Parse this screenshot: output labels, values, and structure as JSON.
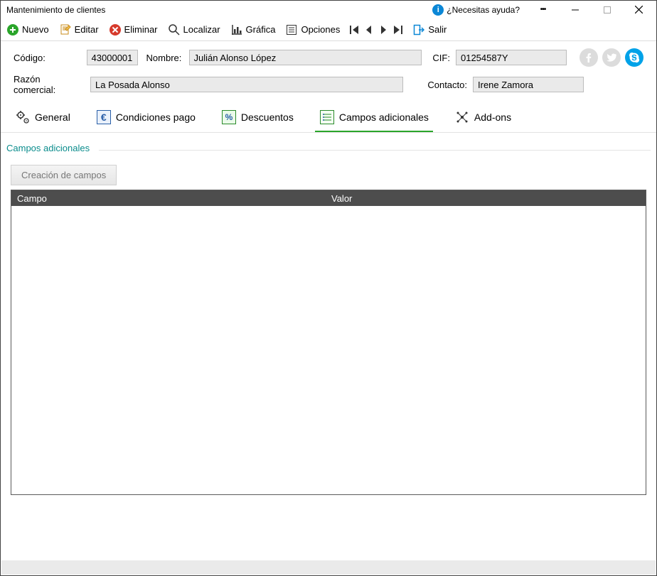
{
  "window": {
    "title": "Mantenimiento de clientes",
    "help_text": "¿Necesitas ayuda?"
  },
  "toolbar": {
    "nuevo": "Nuevo",
    "editar": "Editar",
    "eliminar": "Eliminar",
    "localizar": "Localizar",
    "grafica": "Gráfica",
    "opciones": "Opciones",
    "salir": "Salir"
  },
  "form": {
    "codigo_label": "Código:",
    "codigo_value": "43000001",
    "nombre_label": "Nombre:",
    "nombre_value": "Julián Alonso López",
    "cif_label": "CIF:",
    "cif_value": "01254587Y",
    "razon_label": "Razón comercial:",
    "razon_value": "La Posada Alonso",
    "contacto_label": "Contacto:",
    "contacto_value": "Irene Zamora"
  },
  "tabs": {
    "general": "General",
    "condiciones": "Condiciones pago",
    "descuentos": "Descuentos",
    "campos": "Campos adicionales",
    "addons": "Add-ons"
  },
  "section": {
    "title": "Campos adicionales",
    "create_btn": "Creación de campos",
    "col_campo": "Campo",
    "col_valor": "Valor"
  }
}
